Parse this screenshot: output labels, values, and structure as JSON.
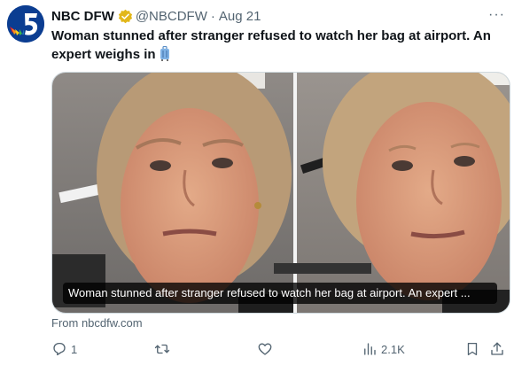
{
  "tweet": {
    "display_name": "NBC DFW",
    "handle": "@NBCDFW",
    "separator": "·",
    "date": "Aug 21",
    "text": "Woman stunned after stranger refused to watch her bag at airport. An expert weighs in",
    "text_emoji": "luggage-icon",
    "more_icon": "···"
  },
  "card": {
    "caption": "Woman stunned after stranger refused to watch her bag at airport. An expert ...",
    "source": "From nbcdfw.com"
  },
  "actions": {
    "replies": "1",
    "retweets": "",
    "likes": "",
    "views": "2.1K"
  },
  "colors": {
    "text": "#0f1419",
    "muted": "#536471",
    "verified_gold": "#e2b719",
    "avatar_blue": "#0b3d91"
  }
}
